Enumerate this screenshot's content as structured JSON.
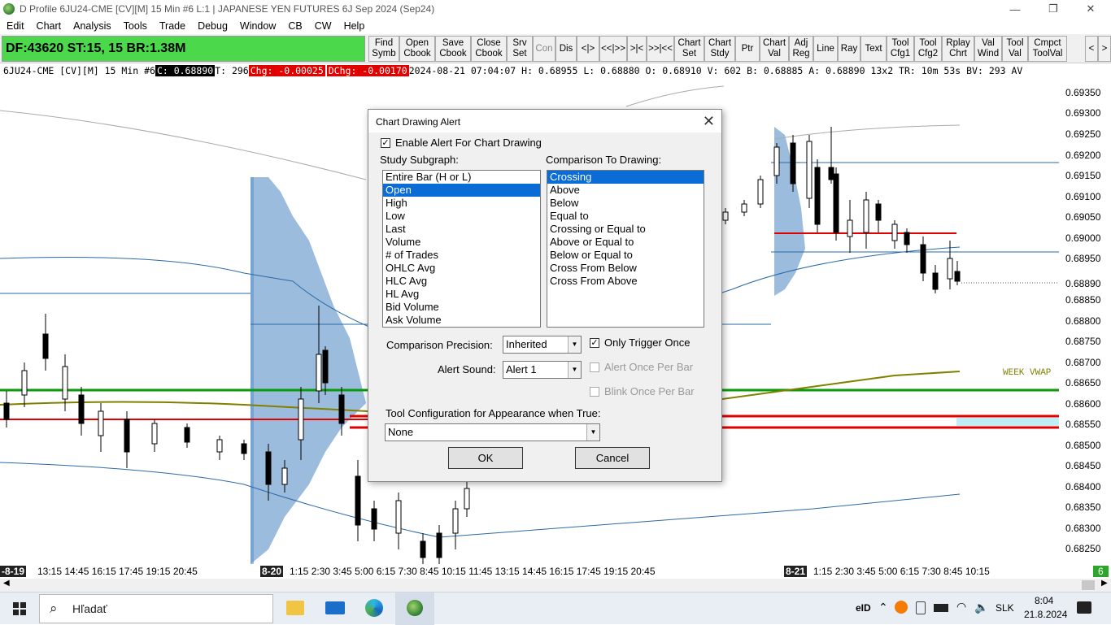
{
  "window": {
    "title": "D Profile 6JU24-CME [CV][M]  15 Min  #6 L:1 | JAPANESE YEN FUTURES 6J Sep 2024 (Sep24)",
    "minimize": "—",
    "maximize": "❐",
    "close": "✕"
  },
  "menu": [
    "Edit",
    "Chart",
    "Analysis",
    "Tools",
    "Trade",
    "Debug",
    "Window",
    "CB",
    "CW",
    "Help"
  ],
  "status_box": "DF:43620  ST:15, 15  BR:1.38M",
  "toolbar_buttons": [
    {
      "label": "Find\nSymb"
    },
    {
      "label": "Open\nCbook"
    },
    {
      "label": "Save\nCbook"
    },
    {
      "label": "Close\nCbook"
    },
    {
      "label": "Srv\nSet"
    },
    {
      "label": "Con"
    },
    {
      "label": "Dis"
    },
    {
      "label": "<|>"
    },
    {
      "label": "<<|>>"
    },
    {
      "label": ">|<"
    },
    {
      "label": ">>|<<"
    },
    {
      "label": "Chart\nSet"
    },
    {
      "label": "Chart\nStdy"
    },
    {
      "label": "Ptr"
    },
    {
      "label": "Chart\nVal"
    },
    {
      "label": "Adj\nReg"
    },
    {
      "label": "Line"
    },
    {
      "label": "Ray"
    },
    {
      "label": "Text"
    },
    {
      "label": "Tool\nCfg1"
    },
    {
      "label": "Tool\nCfg2"
    },
    {
      "label": "Rplay\nChrt"
    },
    {
      "label": "Val\nWind"
    },
    {
      "label": "Tool\nVal"
    },
    {
      "label": "Cmpct\nToolVal"
    },
    {
      "label": "<"
    },
    {
      "label": ">"
    }
  ],
  "info": {
    "symbol": "6JU24-CME [CV][M]  15 Min  #6 ",
    "close": "C: 0.68890",
    "trades": " T: 296 ",
    "chg": "Chg: -0.00025",
    "dchg": "DChg: -0.00170",
    "rest": " 2024-08-21 07:04:07 H: 0.68955 L: 0.68880 O: 0.68910 V: 602 B: 0.68885 A: 0.68890 13x2 TR: 10m 53s BV: 293 AV"
  },
  "price_axis": [
    "0.69350",
    "0.69300",
    "0.69250",
    "0.69200",
    "0.69150",
    "0.69100",
    "0.69050",
    "0.69000",
    "0.68950",
    "0.68890",
    "0.68850",
    "0.68800",
    "0.68750",
    "0.68700",
    "0.68650",
    "0.68600",
    "0.68550",
    "0.68500",
    "0.68450",
    "0.68400",
    "0.68350",
    "0.68300",
    "0.68250"
  ],
  "chart_label_vwap": "WEEK VWAP",
  "time_axis": {
    "day1": "-8-19",
    "times1": "13:15  14:45  16:15  17:45  19:15  20:45",
    "day2": "8-20",
    "times2": "1:15  2:30  3:45  5:00  6:15  7:30  8:45  10:15  11:45  13:15  14:45  16:15  17:45  19:15  20:45",
    "day3": "8-21",
    "times3": "1:15  2:30  3:45  5:00  6:15  7:30  8:45  10:15",
    "badge": "6"
  },
  "dialog": {
    "title": "Chart Drawing Alert",
    "enable_label": "Enable Alert For Chart Drawing",
    "subgraph_label": "Study Subgraph:",
    "comparison_label": "Comparison To Drawing:",
    "subgraph_items": [
      "Entire Bar (H or L)",
      "Open",
      "High",
      "Low",
      "Last",
      "Volume",
      "# of Trades",
      "OHLC Avg",
      "HLC Avg",
      "HL Avg",
      "Bid Volume",
      "Ask Volume"
    ],
    "subgraph_selected": 1,
    "comparison_items": [
      "Crossing",
      "Above",
      "Below",
      "Equal to",
      "Crossing or Equal to",
      "Above or Equal to",
      "Below or Equal to",
      "Cross From Below",
      "Cross From Above"
    ],
    "comparison_selected": 0,
    "precision_label": "Comparison Precision:",
    "precision_value": "Inherited",
    "only_once_label": "Only Trigger Once",
    "sound_label": "Alert Sound:",
    "sound_value": "Alert 1",
    "once_per_bar_label": "Alert Once Per Bar",
    "blink_label": "Blink Once Per Bar",
    "tool_cfg_label": "Tool Configuration for Appearance when True:",
    "tool_cfg_value": "None",
    "ok": "OK",
    "cancel": "Cancel"
  },
  "taskbar": {
    "search": "Hľadať",
    "lang": "SLK",
    "time": "8:04",
    "date": "21.8.2024",
    "eid": "eID"
  }
}
